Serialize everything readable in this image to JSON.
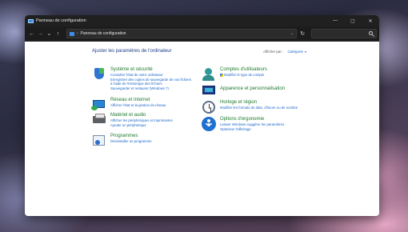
{
  "window": {
    "title": "Panneau de configuration",
    "minimize": "—",
    "maximize": "▢",
    "close": "✕"
  },
  "nav": {
    "back": "←",
    "forward": "→",
    "recent": "⌄",
    "up": "↑",
    "breadcrumb_sep": "›",
    "address": "Panneau de configuration",
    "address_drop": "⌄",
    "refresh": "↻"
  },
  "content": {
    "heading": "Ajuster les paramètres de l'ordinateur",
    "view_by_label": "Afficher par :",
    "view_by_value": "Catégorie",
    "view_by_caret": "▾"
  },
  "left_categories": [
    {
      "title": "Système et sécurité",
      "icon": "shield-icon",
      "links": [
        "Consulter l'état de votre ordinateur",
        "Enregistrer des copies de sauvegarde de vos fichiers",
        "à l'aide de l'Historique des fichiers",
        "Sauvegarder et restaurer (Windows 7)"
      ]
    },
    {
      "title": "Réseau et Internet",
      "icon": "network-icon",
      "links": [
        "Afficher l'état et la gestion du réseau"
      ]
    },
    {
      "title": "Matériel et audio",
      "icon": "printer-icon",
      "links": [
        "Afficher les périphériques et imprimantes",
        "Ajouter un périphérique"
      ]
    },
    {
      "title": "Programmes",
      "icon": "programs-icon",
      "links": [
        "Désinstaller un programme"
      ]
    }
  ],
  "right_categories": [
    {
      "title": "Comptes d'utilisateurs",
      "icon": "users-icon",
      "links": [
        "Modifier le type de compte"
      ]
    },
    {
      "title": "Apparence et personnalisation",
      "icon": "appearance-icon",
      "links": []
    },
    {
      "title": "Horloge et région",
      "icon": "clock-icon",
      "links": [
        "Modifier les formats de date, d'heure ou de nombre"
      ]
    },
    {
      "title": "Options d'ergonomie",
      "icon": "accessibility-icon",
      "links": [
        "Laisser Windows suggérer les paramètres",
        "Optimiser l'affichage"
      ]
    }
  ]
}
